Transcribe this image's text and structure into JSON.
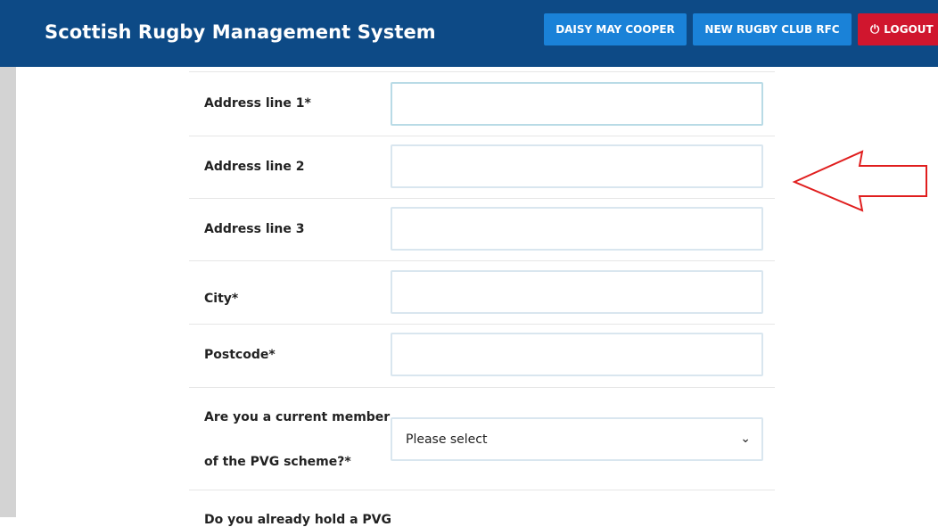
{
  "header": {
    "title": "Scottish Rugby Management System",
    "user_button": "DAISY MAY COOPER",
    "club_button": "NEW RUGBY CLUB RFC",
    "logout_button": "LOGOUT",
    "logout_icon": "power-icon"
  },
  "form": {
    "address1_label": "Address line 1*",
    "address1_value": "",
    "address2_label": "Address line 2",
    "address2_value": "",
    "address3_label": "Address line 3",
    "address3_value": "",
    "city_label": "City*",
    "city_value": "",
    "postcode_label": "Postcode*",
    "postcode_value": "",
    "pvg_label_line1": "Are you a current member",
    "pvg_label_line2": "of the PVG scheme?*",
    "pvg_selected": "Please select",
    "next_label_partial": "Do you already hold a PVG"
  },
  "colors": {
    "header_bg": "#0d4a86",
    "button_blue": "#1a82d8",
    "logout_red": "#d0162e",
    "annotation_arrow": "#e01e1e"
  }
}
